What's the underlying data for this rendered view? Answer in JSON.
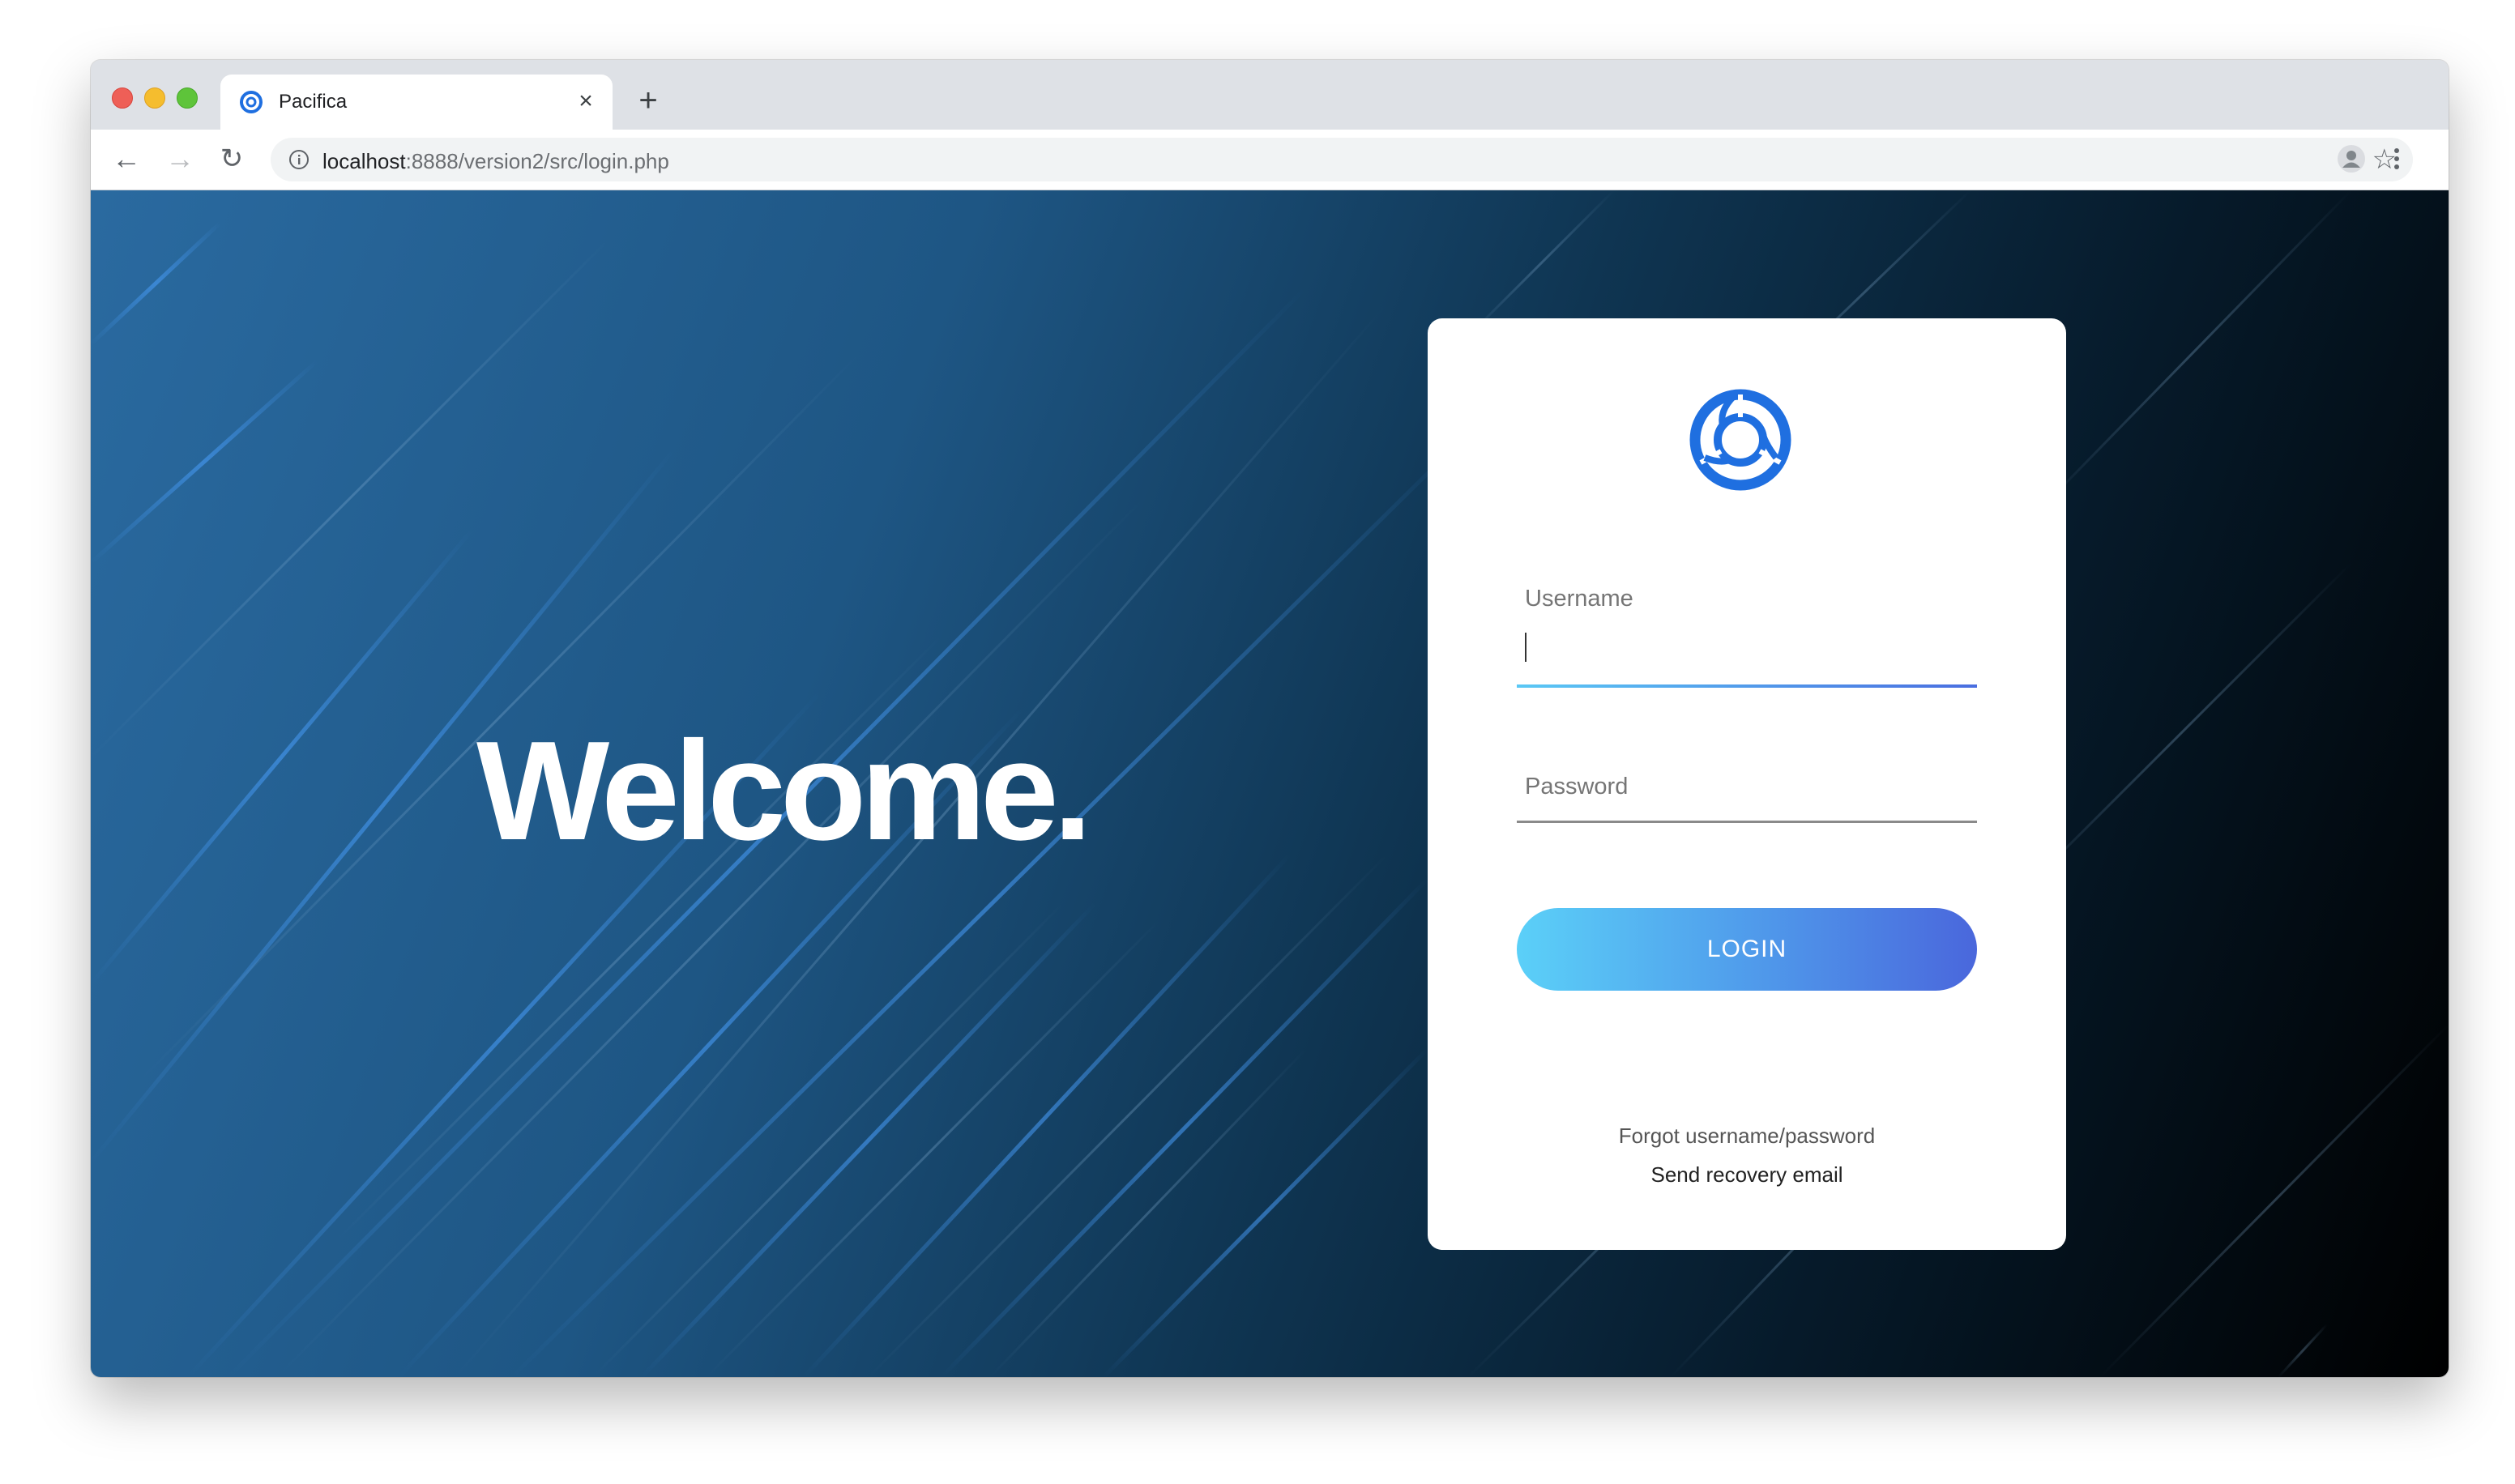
{
  "browser": {
    "tab": {
      "title": "Pacifica"
    },
    "url": {
      "host": "localhost",
      "rest": ":8888/version2/src/login.php"
    }
  },
  "page": {
    "welcome": "Welcome.",
    "login": {
      "username_label": "Username",
      "username_value": "",
      "password_label": "Password",
      "password_value": "",
      "button_label": "LOGIN",
      "forgot_text": "Forgot username/password",
      "recovery_link": "Send recovery email"
    }
  },
  "colors": {
    "brand_blue": "#1f6fe0",
    "button_gradient_start": "#5bd0f8",
    "button_gradient_end": "#4a67dc",
    "background_dark": "#000000",
    "background_blue": "#2a6aa0"
  },
  "icons": [
    "pacifica-logo-icon",
    "close-icon",
    "plus-icon",
    "back-arrow-icon",
    "forward-arrow-icon",
    "reload-icon",
    "info-icon",
    "star-icon",
    "avatar-icon",
    "menu-icon"
  ]
}
